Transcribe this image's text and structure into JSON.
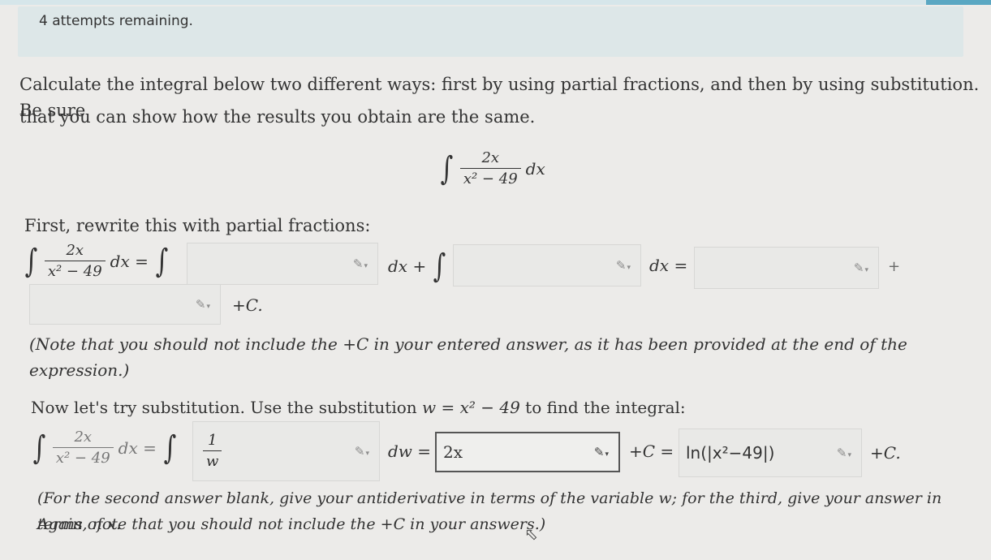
{
  "header": {
    "attempts_text": "4 attempts remaining."
  },
  "intro": {
    "line1": "Calculate the integral below two different ways: first by using partial fractions, and then by using substitution. Be sure",
    "line2": "that you can show how the results you obtain are the same."
  },
  "main_integral": {
    "symbol": "∫",
    "numerator": "2x",
    "denominator": "x² − 49",
    "dx": "dx"
  },
  "partial": {
    "heading": "First, rewrite this with partial fractions:",
    "lhs_numerator": "2x",
    "lhs_denominator": "x² − 49",
    "lhs_dx_eq": "dx =",
    "mid_dx_plus": "dx +",
    "end_dx_eq": "dx =",
    "plus_sign": "+",
    "box1_value": "",
    "box2_value": "",
    "box3_value": "",
    "box4_value": "",
    "const_text": "+C."
  },
  "note1": "(Note that you should not include the +C in your entered answer, as it has been provided at the end of the expression.)",
  "substitution": {
    "heading_pre": "Now let's try substitution. Use the substitution",
    "heading_math": "w = x² − 49",
    "heading_post": "to find the integral:",
    "lhs_numerator": "2x",
    "lhs_denominator": "x² − 49",
    "lhs_dx_eq": "dx =",
    "rhs_numerator": "1",
    "rhs_denominator": "w",
    "dw_eq": "dw =",
    "box1_value": "2x",
    "plus_c_eq": "+C =",
    "box2_value": "ln(|x²−49|)",
    "end_text": "+C."
  },
  "note2": {
    "line1": "(For the second answer blank, give your antiderivative in terms of the variable w; for the third, give your answer in terms of x.",
    "line2": "Again, note that you should not include the +C in your answers.)"
  },
  "icons": {
    "pencil": "✎",
    "caret": "▾",
    "cursor": "⬁"
  }
}
